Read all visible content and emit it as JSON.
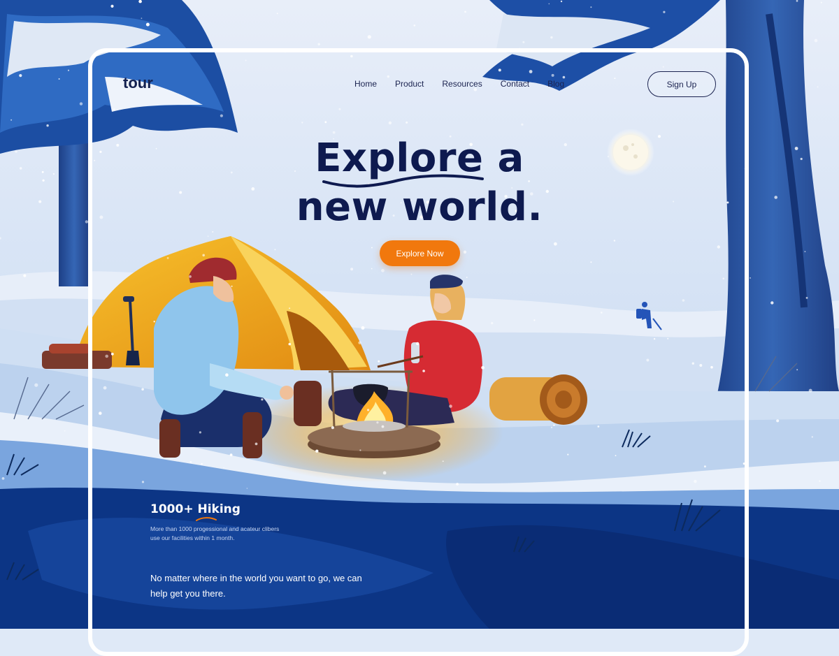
{
  "brand": {
    "logo": "tour"
  },
  "nav": {
    "items": [
      "Home",
      "Product",
      "Resources",
      "Contact",
      "Blog"
    ],
    "signup_label": "Sign Up"
  },
  "hero": {
    "title_line1": "Explore a",
    "title_line2": "new world.",
    "cta_label": "Explore Now"
  },
  "stats": {
    "title": "1000+ Hiking",
    "description": "More than 1000 progessional and acateur clibers use our facilities within 1 month."
  },
  "tagline": "No matter where in the world you want to go, we can help get you there.",
  "colors": {
    "primary_text": "#0e1a4f",
    "accent_orange": "#f1780d",
    "deep_blue": "#0c3585",
    "sky": "#dfe9f7"
  }
}
